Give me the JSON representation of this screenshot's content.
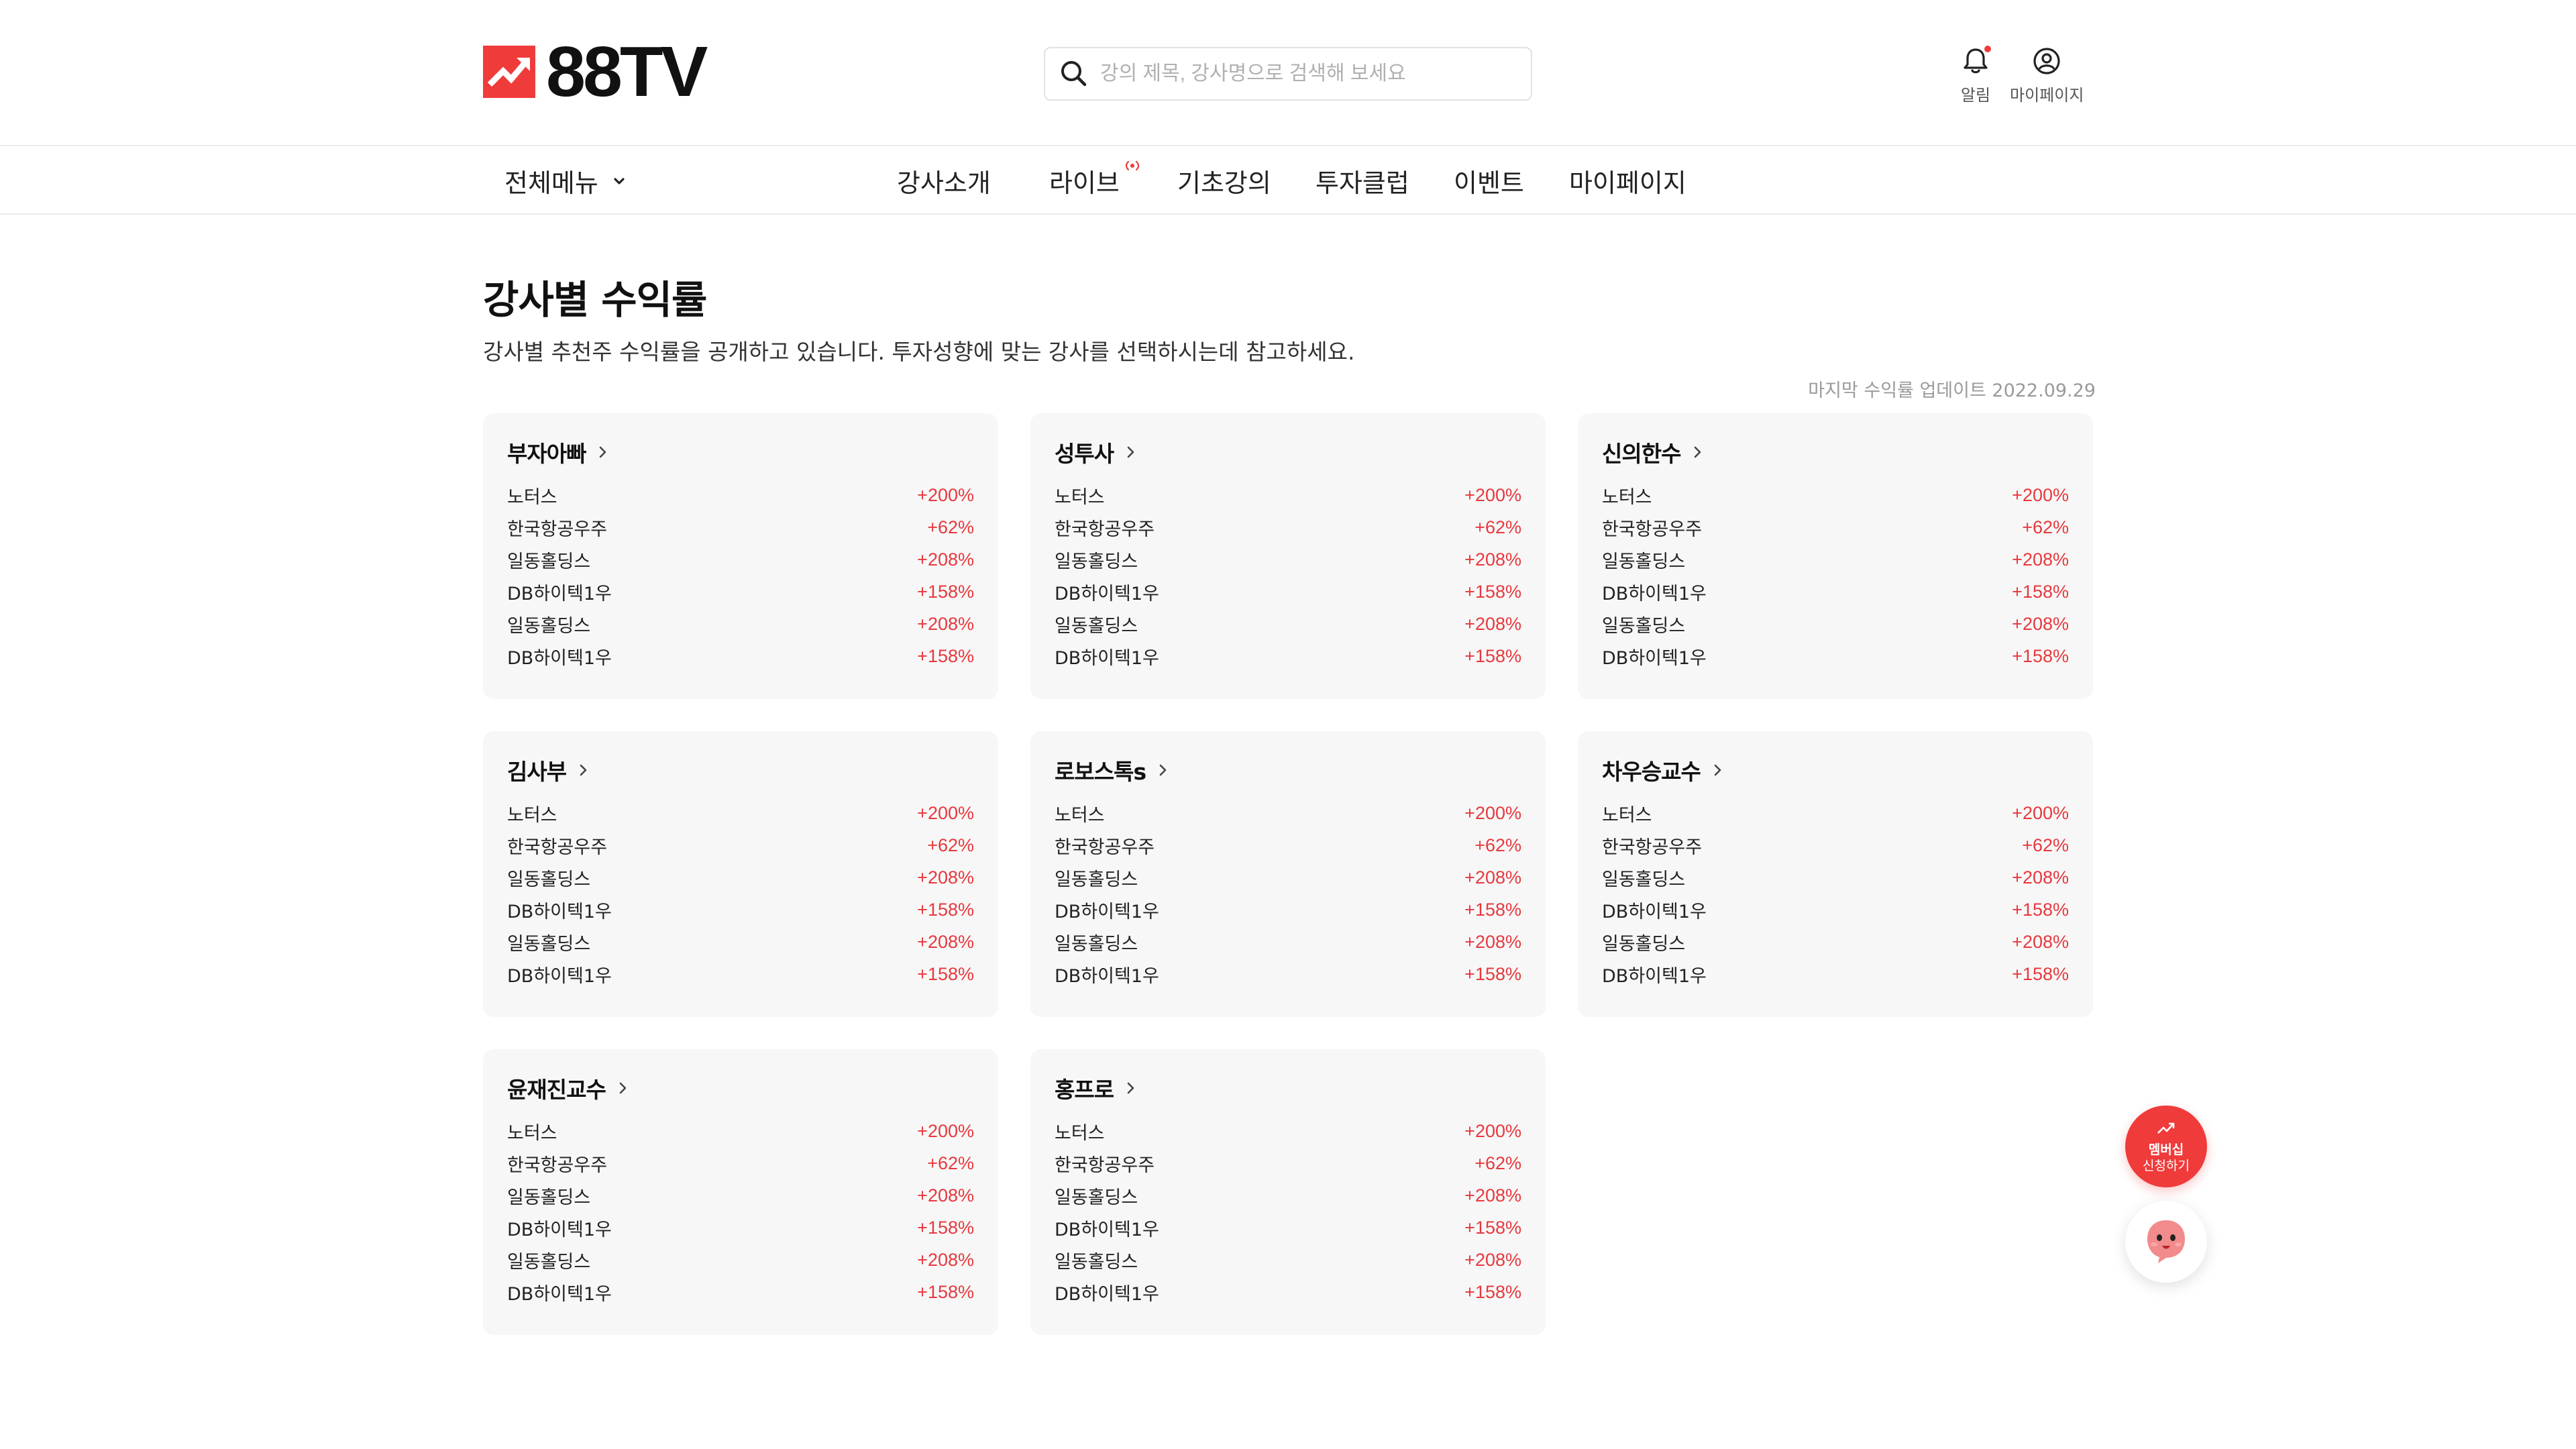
{
  "header": {
    "logo_text": "88TV",
    "search_placeholder": "강의 제목, 강사명으로 검색해 보세요",
    "alarm_label": "알림",
    "mypage_label": "마이페이지"
  },
  "nav": {
    "all_menu": "전체메뉴",
    "items": [
      "강사소개",
      "라이브",
      "기초강의",
      "투자클럽",
      "이벤트",
      "마이페이지"
    ]
  },
  "page": {
    "title": "강사별 수익률",
    "description": "강사별 추천주 수익률을 공개하고 있습니다. 투자성향에 맞는 강사를 선택하시는데 참고하세요.",
    "update_note": "마지막 수익률 업데이트 2022.09.29"
  },
  "cards": [
    {
      "name": "부자아빠",
      "rows": [
        [
          "노터스",
          "+200%"
        ],
        [
          "한국항공우주",
          "+62%"
        ],
        [
          "일동홀딩스",
          "+208%"
        ],
        [
          "DB하이텍1우",
          "+158%"
        ],
        [
          "일동홀딩스",
          "+208%"
        ],
        [
          "DB하이텍1우",
          "+158%"
        ]
      ]
    },
    {
      "name": "성투사",
      "rows": [
        [
          "노터스",
          "+200%"
        ],
        [
          "한국항공우주",
          "+62%"
        ],
        [
          "일동홀딩스",
          "+208%"
        ],
        [
          "DB하이텍1우",
          "+158%"
        ],
        [
          "일동홀딩스",
          "+208%"
        ],
        [
          "DB하이텍1우",
          "+158%"
        ]
      ]
    },
    {
      "name": "신의한수",
      "rows": [
        [
          "노터스",
          "+200%"
        ],
        [
          "한국항공우주",
          "+62%"
        ],
        [
          "일동홀딩스",
          "+208%"
        ],
        [
          "DB하이텍1우",
          "+158%"
        ],
        [
          "일동홀딩스",
          "+208%"
        ],
        [
          "DB하이텍1우",
          "+158%"
        ]
      ]
    },
    {
      "name": "김사부",
      "rows": [
        [
          "노터스",
          "+200%"
        ],
        [
          "한국항공우주",
          "+62%"
        ],
        [
          "일동홀딩스",
          "+208%"
        ],
        [
          "DB하이텍1우",
          "+158%"
        ],
        [
          "일동홀딩스",
          "+208%"
        ],
        [
          "DB하이텍1우",
          "+158%"
        ]
      ]
    },
    {
      "name": "로보스톡s",
      "rows": [
        [
          "노터스",
          "+200%"
        ],
        [
          "한국항공우주",
          "+62%"
        ],
        [
          "일동홀딩스",
          "+208%"
        ],
        [
          "DB하이텍1우",
          "+158%"
        ],
        [
          "일동홀딩스",
          "+208%"
        ],
        [
          "DB하이텍1우",
          "+158%"
        ]
      ]
    },
    {
      "name": "차우승교수",
      "rows": [
        [
          "노터스",
          "+200%"
        ],
        [
          "한국항공우주",
          "+62%"
        ],
        [
          "일동홀딩스",
          "+208%"
        ],
        [
          "DB하이텍1우",
          "+158%"
        ],
        [
          "일동홀딩스",
          "+208%"
        ],
        [
          "DB하이텍1우",
          "+158%"
        ]
      ]
    },
    {
      "name": "윤재진교수",
      "rows": [
        [
          "노터스",
          "+200%"
        ],
        [
          "한국항공우주",
          "+62%"
        ],
        [
          "일동홀딩스",
          "+208%"
        ],
        [
          "DB하이텍1우",
          "+158%"
        ],
        [
          "일동홀딩스",
          "+208%"
        ],
        [
          "DB하이텍1우",
          "+158%"
        ]
      ]
    },
    {
      "name": "홍프로",
      "rows": [
        [
          "노터스",
          "+200%"
        ],
        [
          "한국항공우주",
          "+62%"
        ],
        [
          "일동홀딩스",
          "+208%"
        ],
        [
          "DB하이텍1우",
          "+158%"
        ],
        [
          "일동홀딩스",
          "+208%"
        ],
        [
          "DB하이텍1우",
          "+158%"
        ]
      ]
    }
  ],
  "floating": {
    "member_line1": "멤버십",
    "member_line2": "신청하기"
  },
  "colors": {
    "brand": "#f03b3b",
    "profit": "#e8383d",
    "card_bg": "#f7f7f7"
  },
  "icons": [
    "logo-mark-icon",
    "search-icon",
    "bell-icon",
    "user-circle-icon",
    "chevron-down-icon",
    "live-broadcast-icon",
    "chevron-right-icon",
    "chart-up-icon",
    "chat-character-icon"
  ]
}
